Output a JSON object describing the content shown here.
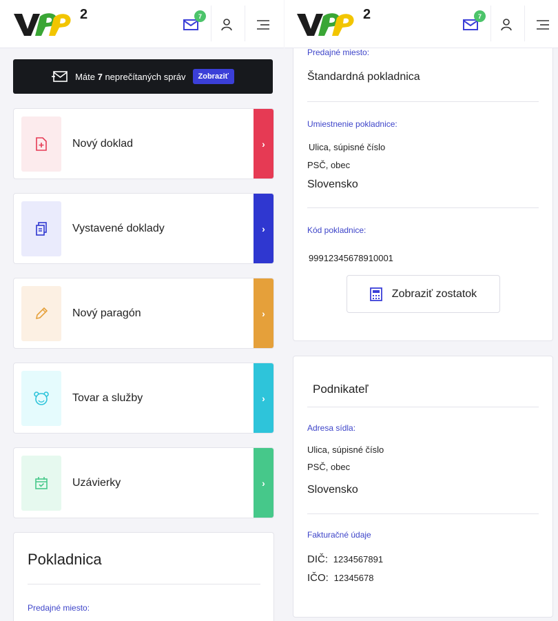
{
  "header": {
    "logo_text": "VRP",
    "logo_superscript": "2",
    "mail_badge": "7",
    "icons": [
      "mail-icon",
      "user-icon",
      "menu-icon"
    ]
  },
  "messages": {
    "prefix": "Máte ",
    "count": "7",
    "suffix": " neprečítaných správ",
    "button": "Zobraziť"
  },
  "tiles": [
    {
      "label": "Nový doklad",
      "icon": "file-plus-icon",
      "color": "#e63a54",
      "bg": "#fcebed"
    },
    {
      "label": "Vystavené doklady",
      "icon": "documents-icon",
      "color": "#2f37d0",
      "bg": "#eaebfc"
    },
    {
      "label": "Nový paragón",
      "icon": "pencil-icon",
      "color": "#e5a03a",
      "bg": "#fcf0e3"
    },
    {
      "label": "Tovar a služby",
      "icon": "bear-icon",
      "color": "#2ec4da",
      "bg": "#e5fbfd"
    },
    {
      "label": "Uzávierky",
      "icon": "calendar-check-icon",
      "color": "#46c88a",
      "bg": "#e6f9ef"
    }
  ],
  "tile_arrow": "›",
  "pokladnica": {
    "title": "Pokladnica",
    "predajne_label": "Predajné miesto:"
  },
  "right_panel": {
    "predajne_label": "Predajné miesto:",
    "predajne_value": "Štandardná pokladnica",
    "umiestnenie_label": "Umiestnenie pokladnice:",
    "address_line1": "Ulica, súpisné číslo",
    "address_line2": "PSČ, obec",
    "address_country": "Slovensko",
    "kod_label": "Kód pokladnice:",
    "kod_value": "99912345678910001",
    "zostatok_button": "Zobraziť zostatok"
  },
  "podnikatel": {
    "title": "Podnikateľ",
    "sidlo_label": "Adresa sídla:",
    "address_line1": "Ulica, súpisné číslo",
    "address_line2": "PSČ, obec",
    "address_country": "Slovensko",
    "fakturacne_label": "Fakturačné údaje",
    "dic_label": "DIČ:",
    "dic_value": "1234567891",
    "ico_label": "IČO:",
    "ico_value": "12345678"
  },
  "colors": {
    "accent_blue": "#3b3fd8",
    "label_blue": "#3d44c9",
    "badge_green": "#4cc46a",
    "logo_dark": "#1c1c1c",
    "logo_green": "#3aa635",
    "logo_yellow": "#f2c500"
  }
}
